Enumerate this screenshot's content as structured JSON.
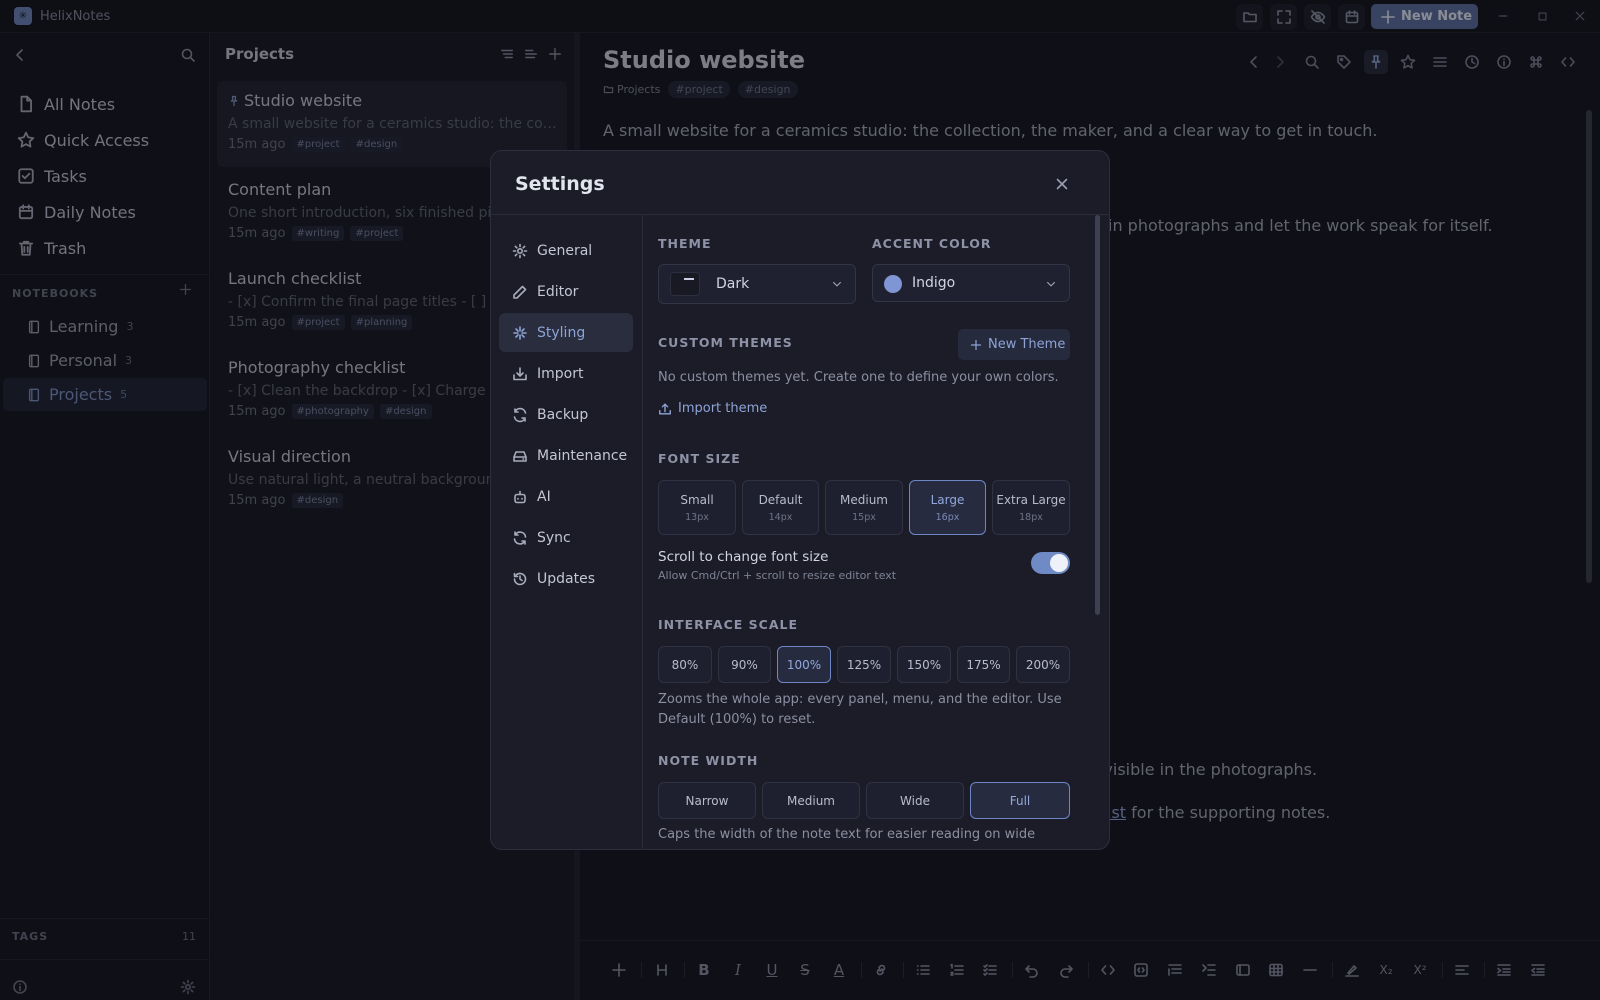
{
  "app": {
    "title": "HelixNotes",
    "new_note_label": "New Note"
  },
  "sidebar": {
    "nav": [
      {
        "label": "All Notes",
        "icon": "file-icon"
      },
      {
        "label": "Quick Access",
        "icon": "star-icon"
      },
      {
        "label": "Tasks",
        "icon": "checkbox-icon"
      },
      {
        "label": "Daily Notes",
        "icon": "calendar-icon"
      },
      {
        "label": "Trash",
        "icon": "trash-icon"
      }
    ],
    "notebooks_header": "NOTEBOOKS",
    "notebooks": [
      {
        "label": "Learning",
        "count": "3"
      },
      {
        "label": "Personal",
        "count": "3"
      },
      {
        "label": "Projects",
        "count": "5",
        "active": true
      }
    ],
    "tags_label": "TAGS",
    "tags_count": "11"
  },
  "notelist": {
    "title": "Projects",
    "notes": [
      {
        "title": "Studio website",
        "snippet": "A small website for a ceramics studio: the collection, the maker, and a clear way to get in touch.",
        "time": "15m ago",
        "tags": [
          "#project",
          "#design"
        ],
        "pinned": true
      },
      {
        "title": "Content plan",
        "snippet": "One short introduction, six finished pieces",
        "time": "15m ago",
        "tags": [
          "#writing",
          "#project"
        ]
      },
      {
        "title": "Launch checklist",
        "snippet": "- [x] Confirm the final page titles - [ ] Pr",
        "time": "15m ago",
        "tags": [
          "#project",
          "#planning"
        ]
      },
      {
        "title": "Photography checklist",
        "snippet": "- [x] Clean the backdrop - [x] Charge",
        "time": "15m ago",
        "tags": [
          "#photography",
          "#design"
        ]
      },
      {
        "title": "Visual direction",
        "snippet": "Use natural light, a neutral background",
        "time": "15m ago",
        "tags": [
          "#design"
        ]
      }
    ]
  },
  "editor": {
    "title": "Studio website",
    "breadcrumb_folder": "Projects",
    "tags": [
      "#project",
      "#design"
    ],
    "para1": "A small website for a ceramics studio: the collection, the maker, and a clear way to get in touch.",
    "para2": "in photographs and let the work speak for itself.",
    "para3": "s visible in the photographs.",
    "para4_link": "ist",
    "para4_rest": " for the supporting notes."
  },
  "settings": {
    "title": "Settings",
    "nav": [
      {
        "label": "General",
        "icon": "gear-icon"
      },
      {
        "label": "Editor",
        "icon": "pencil-icon"
      },
      {
        "label": "Styling",
        "icon": "sparkle-icon",
        "active": true
      },
      {
        "label": "Import",
        "icon": "import-icon"
      },
      {
        "label": "Backup",
        "icon": "backup-icon"
      },
      {
        "label": "Maintenance",
        "icon": "drive-icon"
      },
      {
        "label": "AI",
        "icon": "robot-icon"
      },
      {
        "label": "Sync",
        "icon": "sync-icon"
      },
      {
        "label": "Updates",
        "icon": "history-icon"
      }
    ],
    "theme_label": "THEME",
    "theme_value": "Dark",
    "accent_label": "ACCENT COLOR",
    "accent_value": "Indigo",
    "accent_color": "#7f95d4",
    "custom_themes_label": "CUSTOM THEMES",
    "new_theme_label": "New Theme",
    "custom_themes_empty": "No custom themes yet. Create one to define your own colors.",
    "import_theme_label": "Import theme",
    "font_size_label": "FONT SIZE",
    "font_sizes": [
      {
        "label": "Small",
        "sub": "13px"
      },
      {
        "label": "Default",
        "sub": "14px"
      },
      {
        "label": "Medium",
        "sub": "15px"
      },
      {
        "label": "Large",
        "sub": "16px",
        "selected": true
      },
      {
        "label": "Extra Large",
        "sub": "18px"
      }
    ],
    "scroll_font_title": "Scroll to change font size",
    "scroll_font_desc": "Allow Cmd/Ctrl + scroll to resize editor text",
    "scroll_font_enabled": true,
    "interface_scale_label": "INTERFACE SCALE",
    "scales": [
      "80%",
      "90%",
      "100%",
      "125%",
      "150%",
      "175%",
      "200%"
    ],
    "scale_selected": "100%",
    "scale_desc": "Zooms the whole app: every panel, menu, and the editor. Use Default (100%) to reset.",
    "note_width_label": "NOTE WIDTH",
    "widths": [
      "Narrow",
      "Medium",
      "Wide",
      "Full"
    ],
    "width_selected": "Full",
    "width_desc": "Caps the width of the note text for easier reading on wide"
  }
}
